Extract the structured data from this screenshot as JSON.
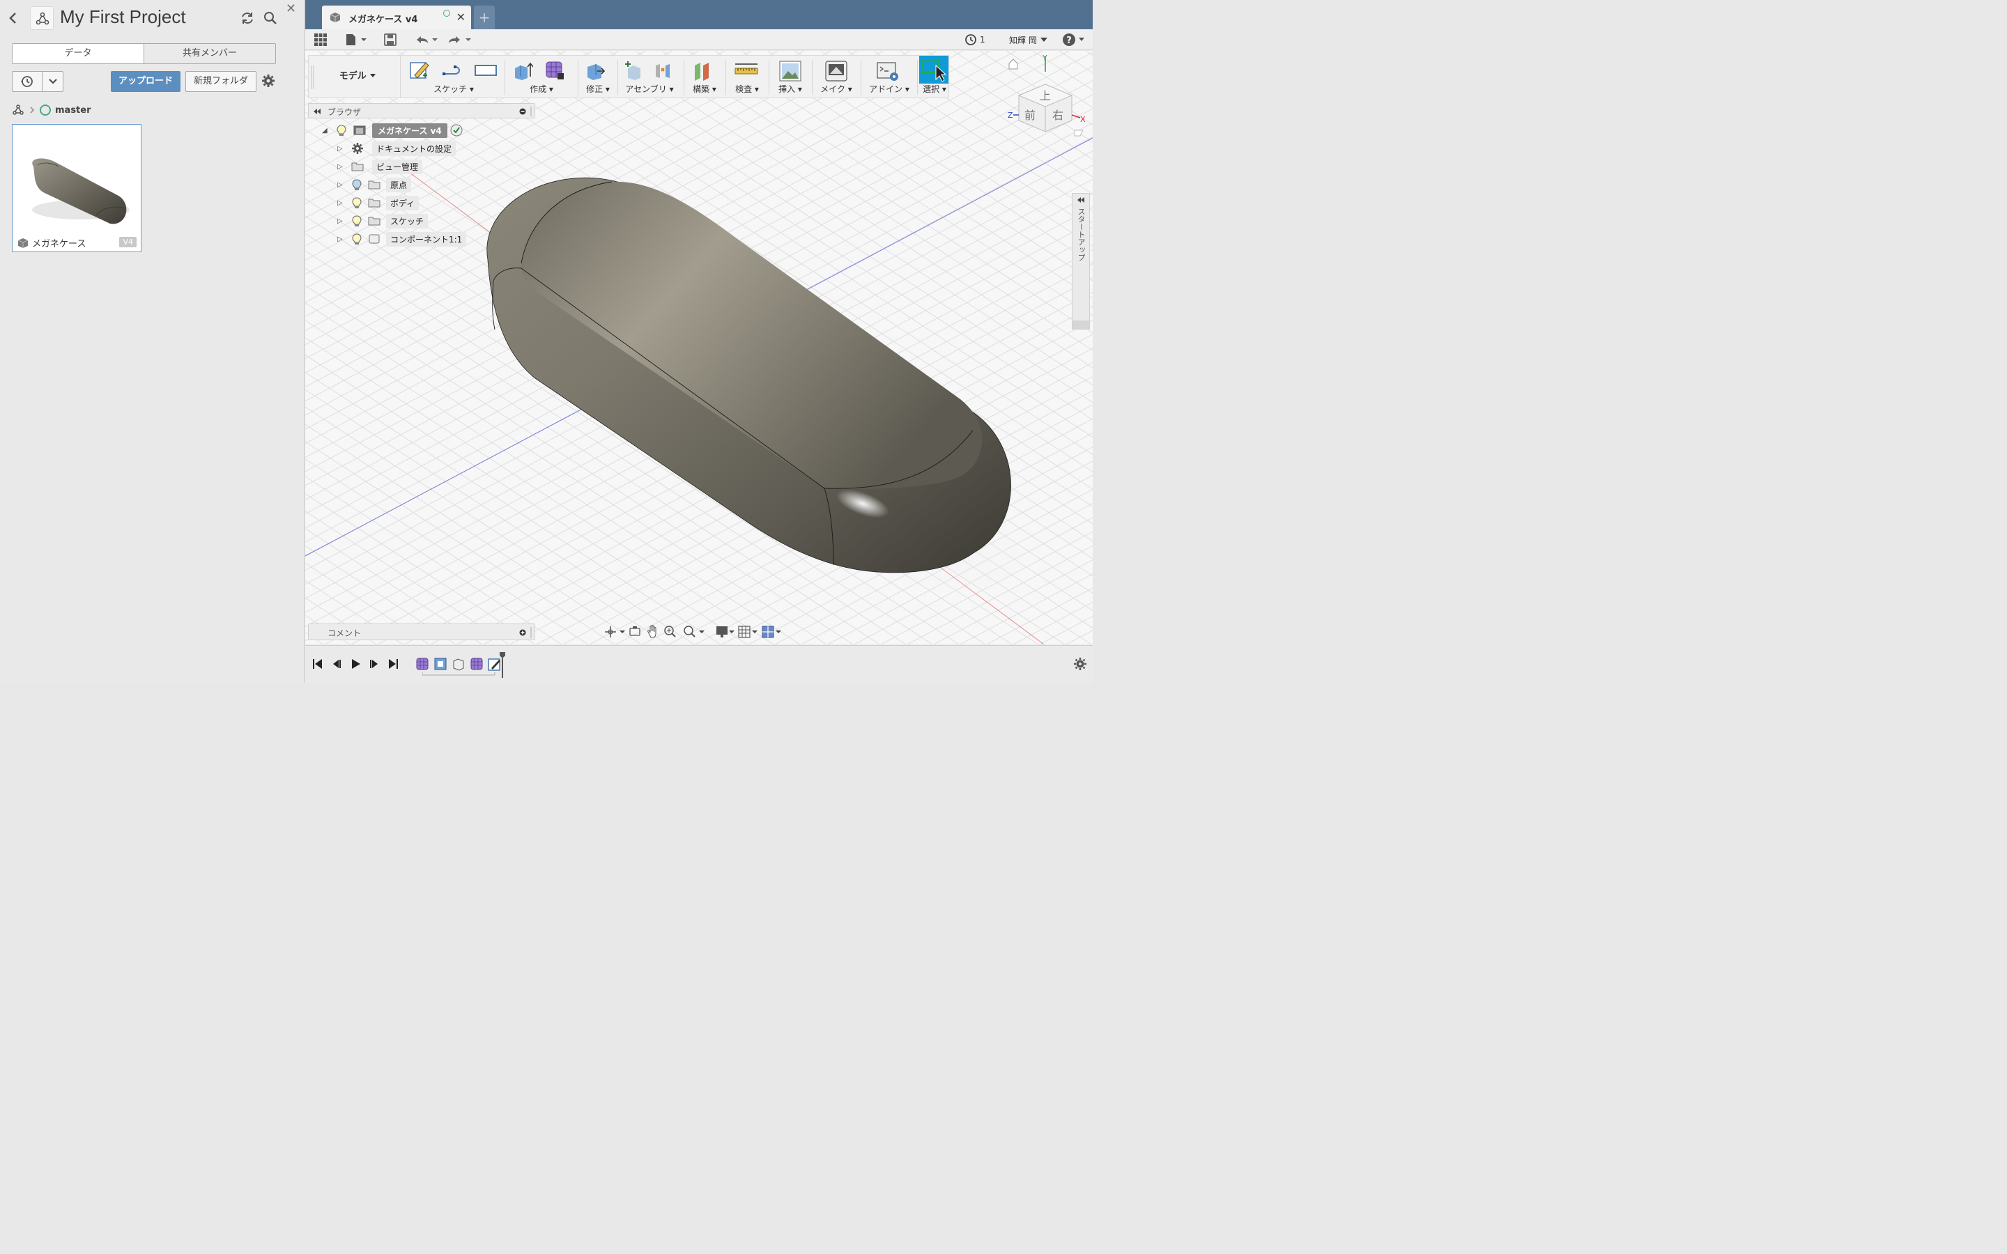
{
  "data_panel": {
    "project_title": "My First Project",
    "tabs": [
      {
        "label": "データ",
        "active": true
      },
      {
        "label": "共有メンバー",
        "active": false
      }
    ],
    "upload_label": "アップロード",
    "new_folder_label": "新規フォルダ",
    "branch": "master",
    "files": [
      {
        "name": "メガネケース",
        "version": "V4"
      }
    ],
    "accent_color": "#5c8ebf"
  },
  "app": {
    "document_tab": {
      "label": "メガネケース v4"
    },
    "quick_access": {
      "jobs_count": "1",
      "user_name": "知輝 岡"
    },
    "ribbon": {
      "workspace": "モデル",
      "groups": [
        {
          "label": "スケッチ"
        },
        {
          "label": "作成"
        },
        {
          "label": "修正"
        },
        {
          "label": "アセンブリ"
        },
        {
          "label": "構築"
        },
        {
          "label": "検査"
        },
        {
          "label": "挿入"
        },
        {
          "label": "メイク"
        },
        {
          "label": "アドイン"
        },
        {
          "label": "選択"
        }
      ]
    },
    "browser": {
      "title": "ブラウザ",
      "root": "メガネケース v4",
      "items": [
        {
          "label": "ドキュメントの設定",
          "icon": "gear-icon"
        },
        {
          "label": "ビュー管理",
          "icon": "folder-icon"
        },
        {
          "label": "原点",
          "icon": "folder-icon"
        },
        {
          "label": "ボディ",
          "icon": "folder-icon"
        },
        {
          "label": "スケッチ",
          "icon": "folder-icon"
        },
        {
          "label": "コンポーネント1:1",
          "icon": "component-icon"
        }
      ]
    },
    "comment_label": "コメント",
    "viewcube": {
      "top": "上",
      "front": "前",
      "right": "右",
      "axis_x": "X",
      "axis_y": "Y",
      "axis_z": "Z"
    },
    "right_panel_label": "スタートアップ",
    "model_color": "#7a766a"
  }
}
